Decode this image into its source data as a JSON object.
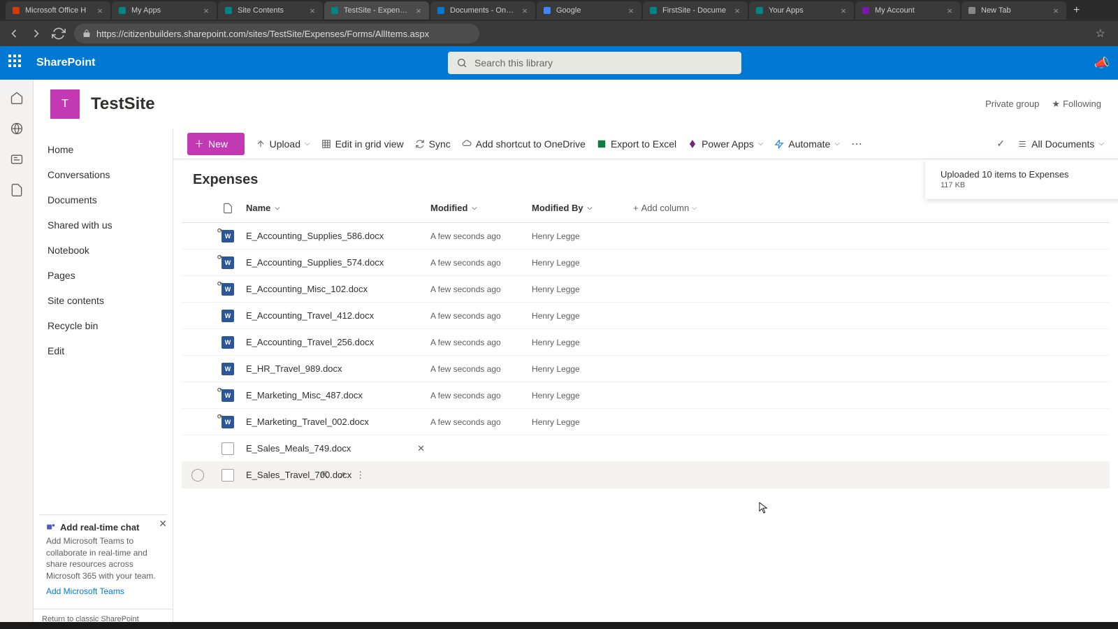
{
  "browser": {
    "tabs": [
      {
        "title": "Microsoft Office H",
        "favicon": "#d83b01"
      },
      {
        "title": "My Apps",
        "favicon": "#038387"
      },
      {
        "title": "Site Contents",
        "favicon": "#038387"
      },
      {
        "title": "TestSite - Expenses",
        "favicon": "#038387",
        "active": true
      },
      {
        "title": "Documents - OneD",
        "favicon": "#0078d4"
      },
      {
        "title": "Google",
        "favicon": "#4285f4"
      },
      {
        "title": "FirstSite - Docume",
        "favicon": "#038387"
      },
      {
        "title": "Your Apps",
        "favicon": "#038387"
      },
      {
        "title": "My Account",
        "favicon": "#7719aa"
      },
      {
        "title": "New Tab",
        "favicon": "#888"
      }
    ],
    "url": "https://citizenbuilders.sharepoint.com/sites/TestSite/Expenses/Forms/AllItems.aspx"
  },
  "suite": {
    "app_name": "SharePoint",
    "search_placeholder": "Search this library"
  },
  "site": {
    "logo_letter": "T",
    "name": "TestSite",
    "privacy": "Private group",
    "following": "Following"
  },
  "left_nav": {
    "items": [
      "Home",
      "Conversations",
      "Documents",
      "Shared with us",
      "Notebook",
      "Pages",
      "Site contents",
      "Recycle bin",
      "Edit"
    ]
  },
  "chat_promo": {
    "title": "Add real-time chat",
    "body": "Add Microsoft Teams to collaborate in real-time and share resources across Microsoft 365 with your team.",
    "link": "Add Microsoft Teams"
  },
  "classic_link": "Return to classic SharePoint",
  "cmd": {
    "new": "New",
    "upload": "Upload",
    "edit_grid": "Edit in grid view",
    "sync": "Sync",
    "shortcut": "Add shortcut to OneDrive",
    "export": "Export to Excel",
    "powerapps": "Power Apps",
    "automate": "Automate",
    "all_documents": "All Documents"
  },
  "library": {
    "title": "Expenses",
    "columns": {
      "name": "Name",
      "modified": "Modified",
      "modified_by": "Modified By",
      "add": "Add column"
    },
    "files": [
      {
        "name": "E_Accounting_Supplies_586.docx",
        "modified": "A few seconds ago",
        "by": "Henry Legge",
        "icon": "word",
        "loading": true
      },
      {
        "name": "E_Accounting_Supplies_574.docx",
        "modified": "A few seconds ago",
        "by": "Henry Legge",
        "icon": "word",
        "loading": true
      },
      {
        "name": "E_Accounting_Misc_102.docx",
        "modified": "A few seconds ago",
        "by": "Henry Legge",
        "icon": "word",
        "loading": true
      },
      {
        "name": "E_Accounting_Travel_412.docx",
        "modified": "A few seconds ago",
        "by": "Henry Legge",
        "icon": "word"
      },
      {
        "name": "E_Accounting_Travel_256.docx",
        "modified": "A few seconds ago",
        "by": "Henry Legge",
        "icon": "word"
      },
      {
        "name": "E_HR_Travel_989.docx",
        "modified": "A few seconds ago",
        "by": "Henry Legge",
        "icon": "word"
      },
      {
        "name": "E_Marketing_Misc_487.docx",
        "modified": "A few seconds ago",
        "by": "Henry Legge",
        "icon": "word",
        "loading": true
      },
      {
        "name": "E_Marketing_Travel_002.docx",
        "modified": "A few seconds ago",
        "by": "Henry Legge",
        "icon": "word",
        "loading": true
      },
      {
        "name": "E_Sales_Meals_749.docx",
        "modified": "",
        "by": "",
        "icon": "generic",
        "processing": true
      },
      {
        "name": "E_Sales_Travel_700.docx",
        "modified": "",
        "by": "",
        "icon": "generic",
        "hovered": true,
        "actions": true
      }
    ]
  },
  "toast": {
    "title": "Uploaded 10 items to Expenses",
    "sub": "117 KB"
  }
}
